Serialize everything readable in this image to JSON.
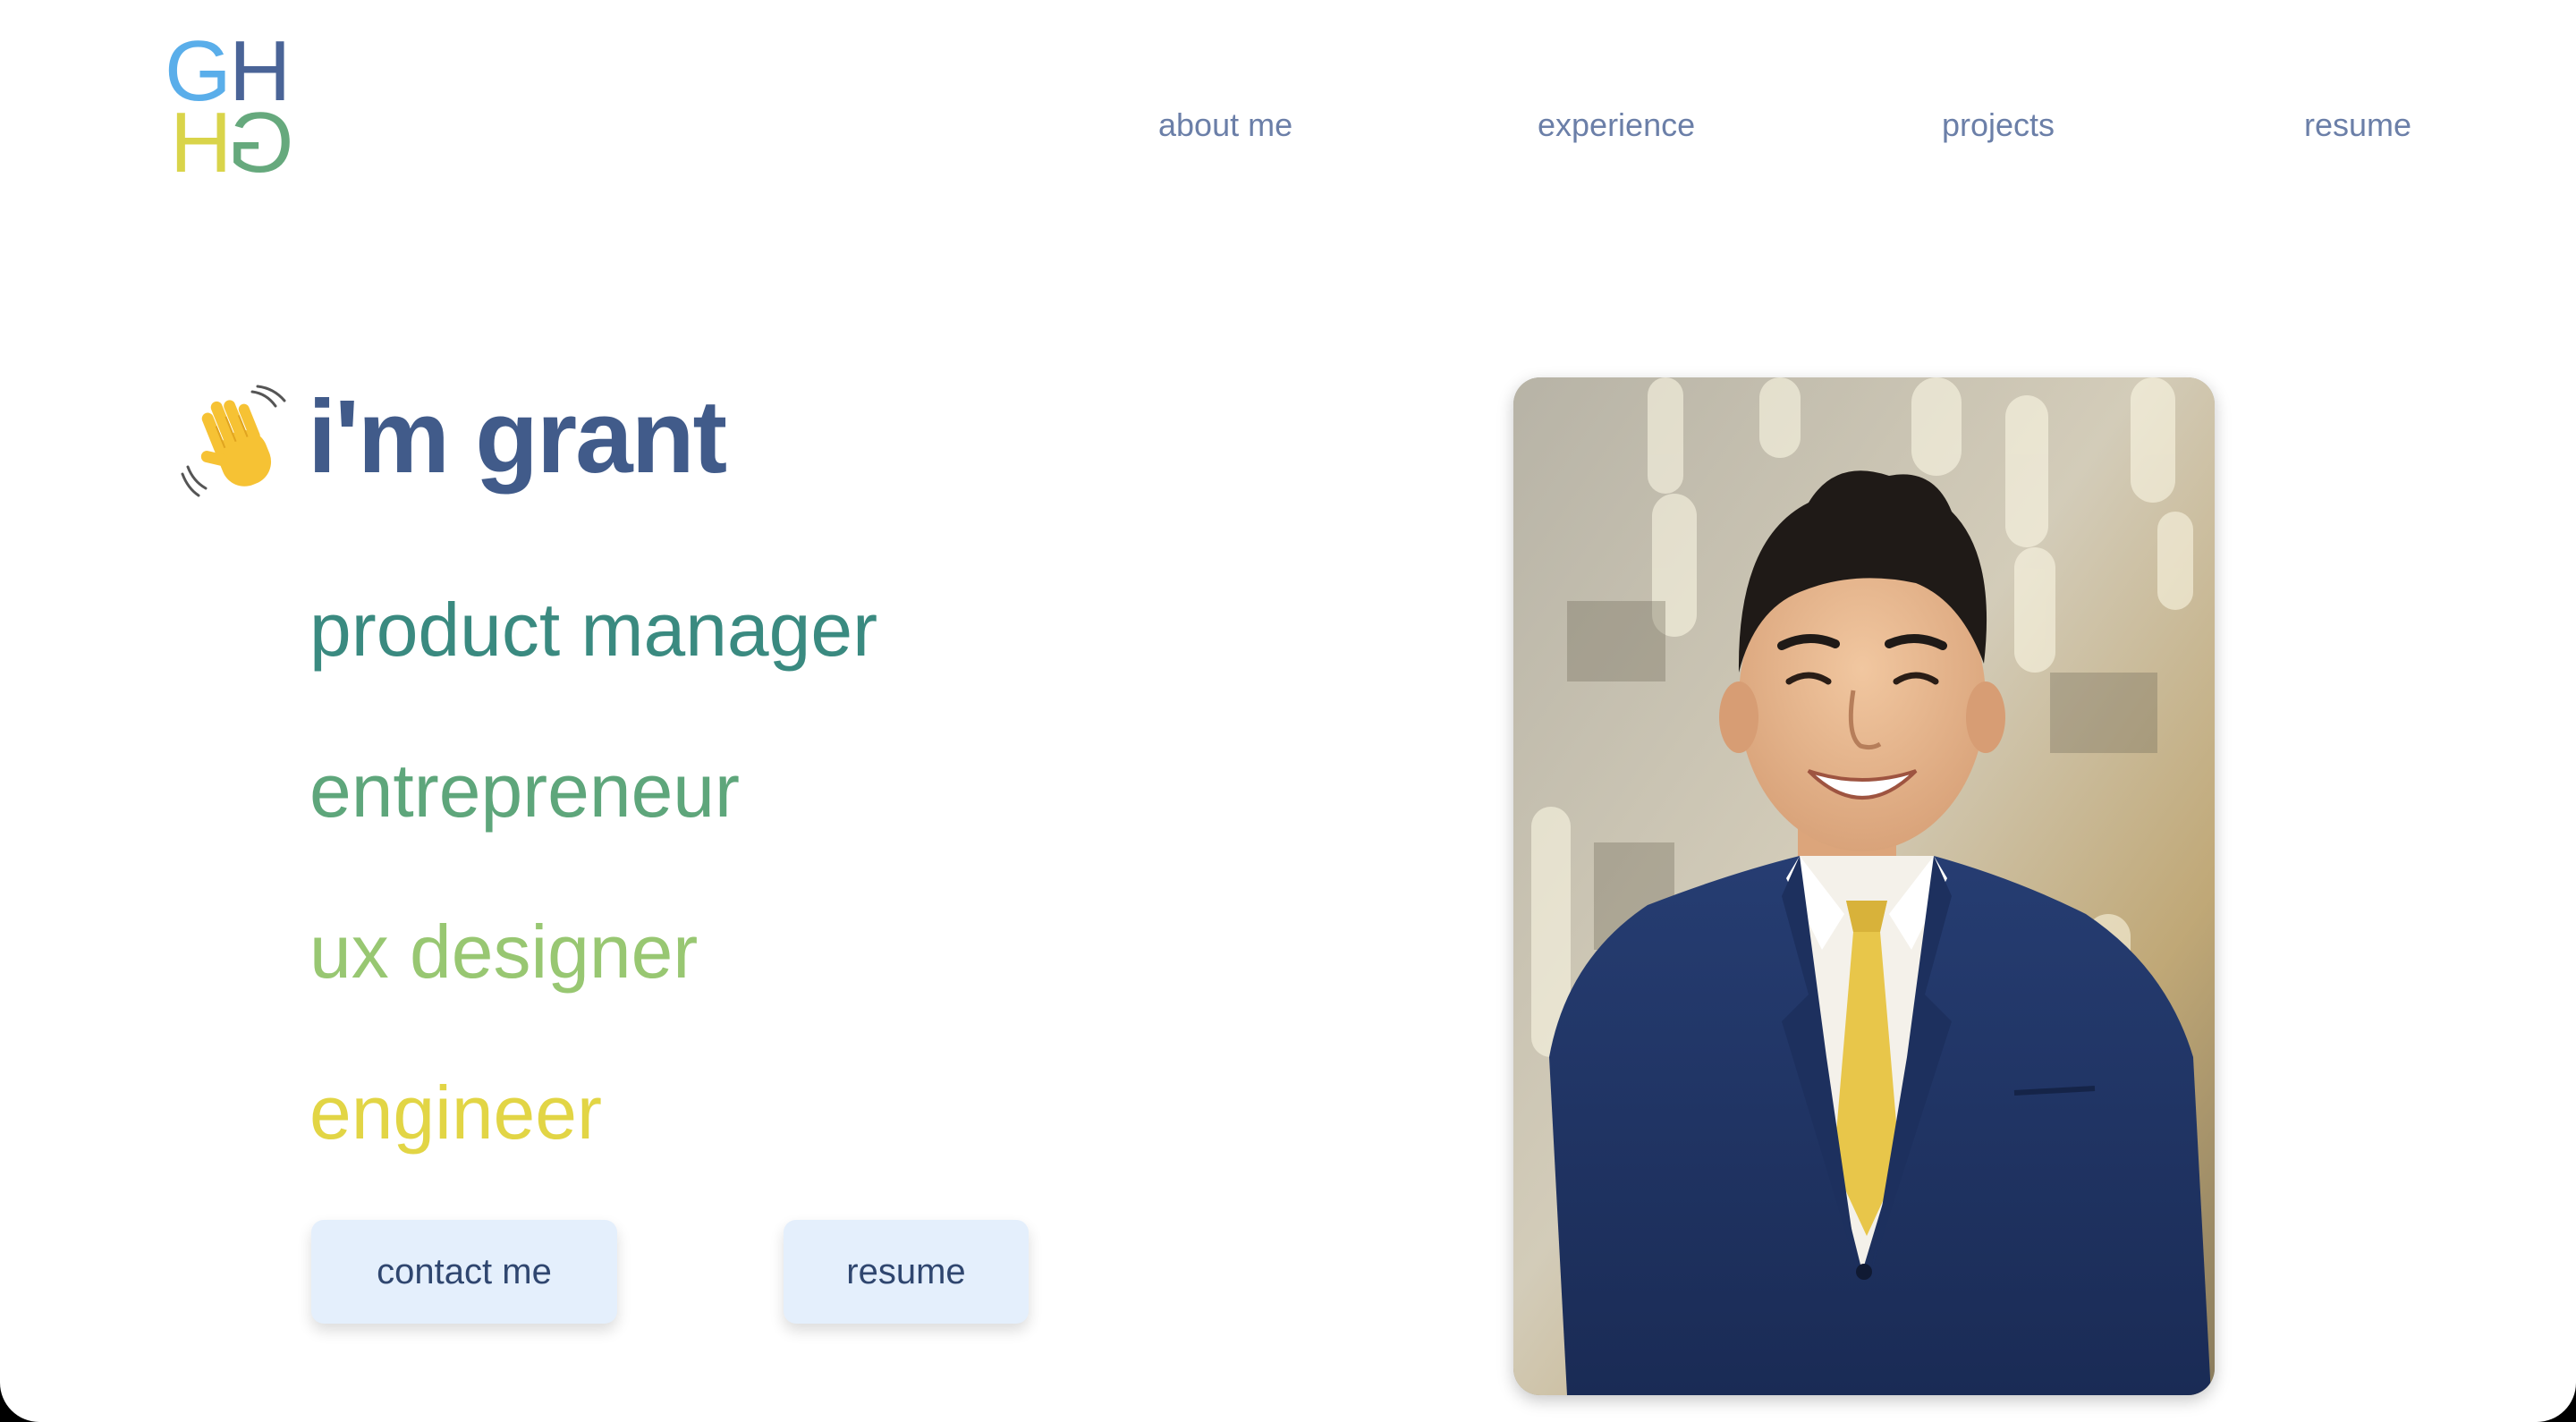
{
  "logo": {
    "letters": [
      "G",
      "H",
      "H",
      "G"
    ],
    "colors": [
      "#5aaeea",
      "#4a6497",
      "#d9d44a",
      "#66a97d"
    ]
  },
  "nav": {
    "items": [
      {
        "label": "about me"
      },
      {
        "label": "experience"
      },
      {
        "label": "projects"
      },
      {
        "label": "resume"
      }
    ],
    "color": "#6b7fa8"
  },
  "hero": {
    "greeting_icon": "waving-hand-icon",
    "title": "i'm grant",
    "title_color": "#415b8a",
    "roles": [
      {
        "label": "product manager",
        "color": "#3a8a80"
      },
      {
        "label": "entrepreneur",
        "color": "#5ea67b"
      },
      {
        "label": "ux designer",
        "color": "#98c772"
      },
      {
        "label": "engineer",
        "color": "#e2d545"
      }
    ],
    "buttons": {
      "contact_label": "contact me",
      "resume_label": "resume"
    },
    "button_bg": "#e4effc"
  },
  "portrait": {
    "subject": "portrait-photo"
  }
}
